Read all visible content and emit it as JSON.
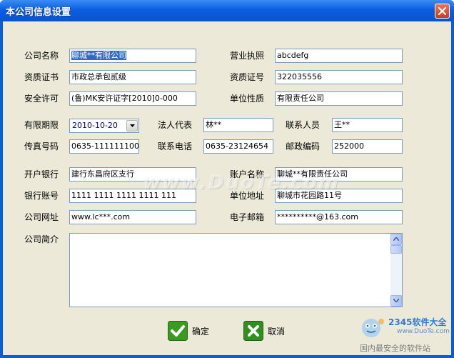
{
  "window": {
    "title": "本公司信息设置"
  },
  "form": {
    "company_name": {
      "label": "公司名称",
      "value": "聊城**有限公司"
    },
    "business_license": {
      "label": "营业执照",
      "value": "abcdefg"
    },
    "qualification_cert": {
      "label": "资质证书",
      "value": "市政总承包贰级"
    },
    "qualification_no": {
      "label": "资质证号",
      "value": "322035556"
    },
    "safety_permit": {
      "label": "安全许可",
      "value": "(鲁)MK安许证字[2010]0-000"
    },
    "unit_nature": {
      "label": "单位性质",
      "value": "有限责任公司"
    },
    "valid_until": {
      "label": "有限期限",
      "value": "2010-10-20"
    },
    "legal_rep": {
      "label": "法人代表",
      "value": "林**"
    },
    "contact_person": {
      "label": "联系人员",
      "value": "王**"
    },
    "fax": {
      "label": "传真号码",
      "value": "0635-111111100"
    },
    "phone": {
      "label": "联系电话",
      "value": "0635-23124654"
    },
    "postcode": {
      "label": "邮政编码",
      "value": "252000"
    },
    "bank": {
      "label": "开户银行",
      "value": "建行东昌府区支行"
    },
    "account_name": {
      "label": "账户名称",
      "value": "聊城**有限责任公司"
    },
    "bank_account": {
      "label": "银行账号",
      "value": "1111 1111 1111 1111 111"
    },
    "address": {
      "label": "单位地址",
      "value": "聊城市花园路11号"
    },
    "website": {
      "label": "公司网址",
      "value": "www.lc***.com"
    },
    "email": {
      "label": "电子邮箱",
      "value": "**********@163.com"
    },
    "profile": {
      "label": "公司简介",
      "value": ""
    }
  },
  "actions": {
    "confirm": "确定",
    "cancel": "取消"
  },
  "overlay": {
    "watermark": "www.DuoTe.com",
    "brand_name": "2345软件大全",
    "brand_url": "www.DuoTe.com",
    "brand_slogan": "国内最安全的软件站"
  },
  "colors": {
    "titlebar": "#0a5ed8",
    "client": "#ece9d8",
    "selection": "#316ac5",
    "ok_green": "#3a9a22",
    "cancel_green": "#2f8f1f"
  }
}
